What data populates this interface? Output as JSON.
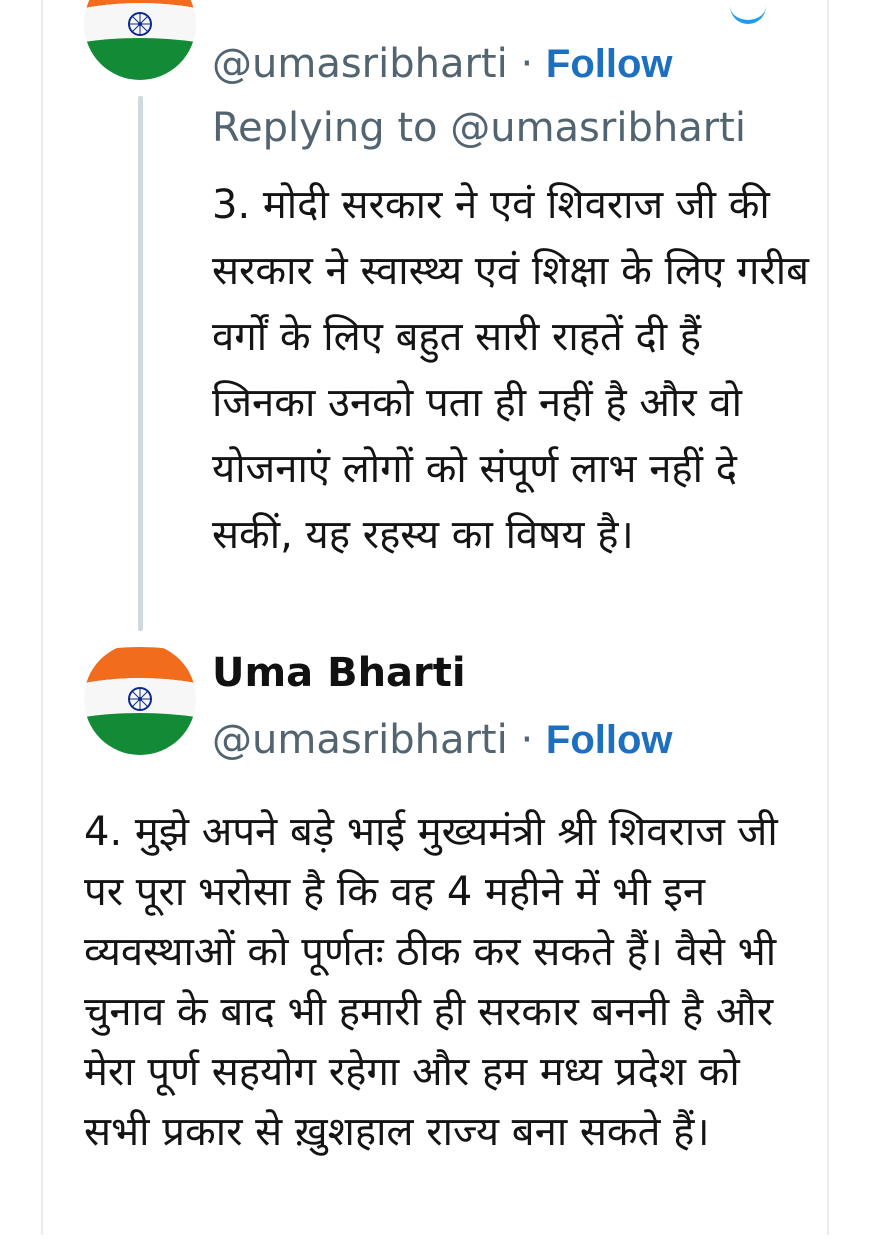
{
  "thread_top": {
    "handle": "@umasribharti",
    "separator": "·",
    "follow_label": "Follow",
    "replying_to": "Replying to @umasribharti",
    "text": "3. मोदी सरकार ने एवं शिवराज जी की सरकार ने स्वास्थ्य एवं शिक्षा के लिए गरीब वर्गों के लिए बहुत सारी राहतें दी हैं जिनका उनको पता ही नहीं है और वो योजनाएं लोगों को संपूर्ण लाभ नहीं दे सकीं, यह रहस्य का विषय है।"
  },
  "main_tweet": {
    "display_name": "Uma Bharti",
    "handle": "@umasribharti",
    "separator": "·",
    "follow_label": "Follow",
    "text": "4. मुझे अपने बड़े भाई मुख्यमंत्री श्री शिवराज जी पर पूरा भरोसा है कि वह 4 महीने में भी इन व्यवस्थाओं को पूर्णतः ठीक कर सकते हैं।  वैसे भी चुनाव के बाद भी हमारी ही सरकार बननी है और मेरा पूर्ण सहयोग रहेगा और हम मध्य प्रदेश को सभी प्रकार से ख़ुशहाल राज्य बना सकते हैं।"
  },
  "colors": {
    "follow": "#1d6fc0",
    "secondary_text": "#536471",
    "saffron": "#f26c1e",
    "green": "#138a36",
    "chakra_blue": "#0a2a8a"
  },
  "icons": {
    "avatar": "indian-flag-avatar"
  }
}
